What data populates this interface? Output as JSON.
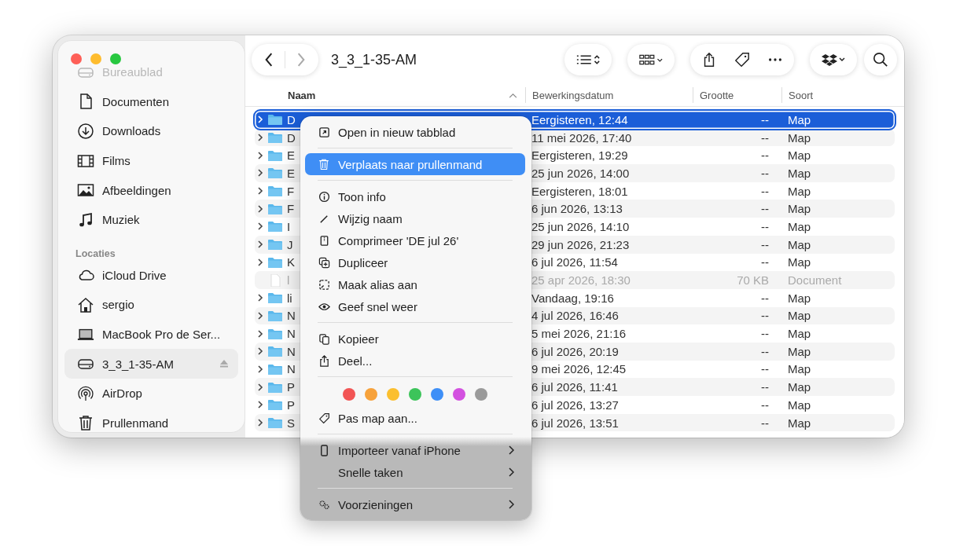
{
  "window": {
    "title": "3_3_1-35-AM"
  },
  "sidebar": {
    "items": [
      {
        "label": "Bureaublad",
        "faded": true,
        "selected": false
      },
      {
        "label": "Documenten",
        "faded": false,
        "selected": false
      },
      {
        "label": "Downloads",
        "faded": false,
        "selected": false
      },
      {
        "label": "Films",
        "faded": false,
        "selected": false
      },
      {
        "label": "Afbeeldingen",
        "faded": false,
        "selected": false
      },
      {
        "label": "Muziek",
        "faded": false,
        "selected": false
      }
    ],
    "section": "Locaties",
    "locations": [
      {
        "label": "iCloud Drive",
        "selected": false,
        "eject": false
      },
      {
        "label": "sergio",
        "selected": false,
        "eject": false
      },
      {
        "label": "MacBook Pro de Ser...",
        "selected": false,
        "eject": false
      },
      {
        "label": "3_3_1-35-AM",
        "selected": true,
        "eject": true
      },
      {
        "label": "AirDrop",
        "selected": false,
        "eject": false
      },
      {
        "label": "Prullenmand",
        "selected": false,
        "eject": false
      }
    ]
  },
  "table": {
    "columns": [
      "Naam",
      "Bewerkingsdatum",
      "Grootte",
      "Soort"
    ],
    "rows": [
      {
        "kind": "folder",
        "name": "D",
        "date": "Eergisteren, 12:44",
        "size": "--",
        "type": "Map",
        "selected": true
      },
      {
        "kind": "folder",
        "name": "D",
        "date": "11 mei 2026, 17:40",
        "size": "--",
        "type": "Map",
        "selected": false
      },
      {
        "kind": "folder",
        "name": "E",
        "date": "Eergisteren, 19:29",
        "size": "--",
        "type": "Map",
        "selected": false
      },
      {
        "kind": "folder",
        "name": "E",
        "date": "25 jun 2026, 14:00",
        "size": "--",
        "type": "Map",
        "selected": false
      },
      {
        "kind": "folder",
        "name": "F",
        "date": "Eergisteren, 18:01",
        "size": "--",
        "type": "Map",
        "selected": false
      },
      {
        "kind": "folder",
        "name": "F",
        "date": "6 jun 2026, 13:13",
        "size": "--",
        "type": "Map",
        "selected": false
      },
      {
        "kind": "folder",
        "name": "I",
        "date": "25 jun 2026, 14:10",
        "size": "--",
        "type": "Map",
        "selected": false
      },
      {
        "kind": "folder",
        "name": "J",
        "date": "29 jun 2026, 21:23",
        "size": "--",
        "type": "Map",
        "selected": false
      },
      {
        "kind": "folder",
        "name": "K",
        "date": "6 jul 2026, 11:54",
        "size": "--",
        "type": "Map",
        "selected": false
      },
      {
        "kind": "document",
        "name": "l",
        "date": "25 apr 2026, 18:30",
        "size": "70 KB",
        "type": "Document",
        "selected": false
      },
      {
        "kind": "folder",
        "name": "li",
        "date": "Vandaag, 19:16",
        "size": "--",
        "type": "Map",
        "selected": false
      },
      {
        "kind": "folder",
        "name": "N",
        "date": "4 jul 2026, 16:46",
        "size": "--",
        "type": "Map",
        "selected": false
      },
      {
        "kind": "folder",
        "name": "N",
        "date": "5 mei 2026, 21:16",
        "size": "--",
        "type": "Map",
        "selected": false
      },
      {
        "kind": "folder",
        "name": "N",
        "date": "6 jul 2026, 20:19",
        "size": "--",
        "type": "Map",
        "selected": false
      },
      {
        "kind": "folder",
        "name": "N",
        "date": "9 mei 2026, 12:45",
        "size": "--",
        "type": "Map",
        "selected": false
      },
      {
        "kind": "folder",
        "name": "P",
        "date": "6 jul 2026, 11:41",
        "size": "--",
        "type": "Map",
        "selected": false
      },
      {
        "kind": "folder",
        "name": "P",
        "date": "6 jul 2026, 13:27",
        "size": "--",
        "type": "Map",
        "selected": false
      },
      {
        "kind": "folder",
        "name": "S",
        "date": "6 jul 2026, 13:51",
        "size": "--",
        "type": "Map",
        "selected": false
      }
    ]
  },
  "context_menu": {
    "items": [
      {
        "kind": "item",
        "label": "Open in nieuw tabblad",
        "selected": false,
        "submenu": false
      },
      {
        "kind": "separator"
      },
      {
        "kind": "item",
        "label": "Verplaats naar prullenmand",
        "selected": true,
        "submenu": false
      },
      {
        "kind": "separator"
      },
      {
        "kind": "item",
        "label": "Toon info",
        "selected": false,
        "submenu": false
      },
      {
        "kind": "item",
        "label": "Wijzig naam",
        "selected": false,
        "submenu": false
      },
      {
        "kind": "item",
        "label": "Comprimeer 'DE jul 26'",
        "selected": false,
        "submenu": false
      },
      {
        "kind": "item",
        "label": "Dupliceer",
        "selected": false,
        "submenu": false
      },
      {
        "kind": "item",
        "label": "Maak alias aan",
        "selected": false,
        "submenu": false
      },
      {
        "kind": "item",
        "label": "Geef snel weer",
        "selected": false,
        "submenu": false
      },
      {
        "kind": "separator"
      },
      {
        "kind": "item",
        "label": "Kopieer",
        "selected": false,
        "submenu": false
      },
      {
        "kind": "item",
        "label": "Deel...",
        "selected": false,
        "submenu": false
      },
      {
        "kind": "separator"
      },
      {
        "kind": "tags",
        "colors": [
          {
            "color": "#f25555"
          },
          {
            "color": "#f7a23b"
          },
          {
            "color": "#fbbf2e"
          },
          {
            "color": "#3cc45a"
          },
          {
            "color": "#3e8ff7"
          },
          {
            "color": "#d351e0"
          },
          {
            "color": "#9a9a9a"
          }
        ]
      },
      {
        "kind": "item",
        "label": "Pas map aan...",
        "selected": false,
        "submenu": false
      },
      {
        "kind": "separator"
      },
      {
        "kind": "item",
        "label": "Importeer vanaf iPhone",
        "selected": false,
        "submenu": true
      },
      {
        "kind": "item",
        "label": "Snelle taken",
        "selected": false,
        "submenu": true
      },
      {
        "kind": "separator"
      },
      {
        "kind": "item",
        "label": "Voorzieningen",
        "selected": false,
        "submenu": true
      }
    ]
  }
}
